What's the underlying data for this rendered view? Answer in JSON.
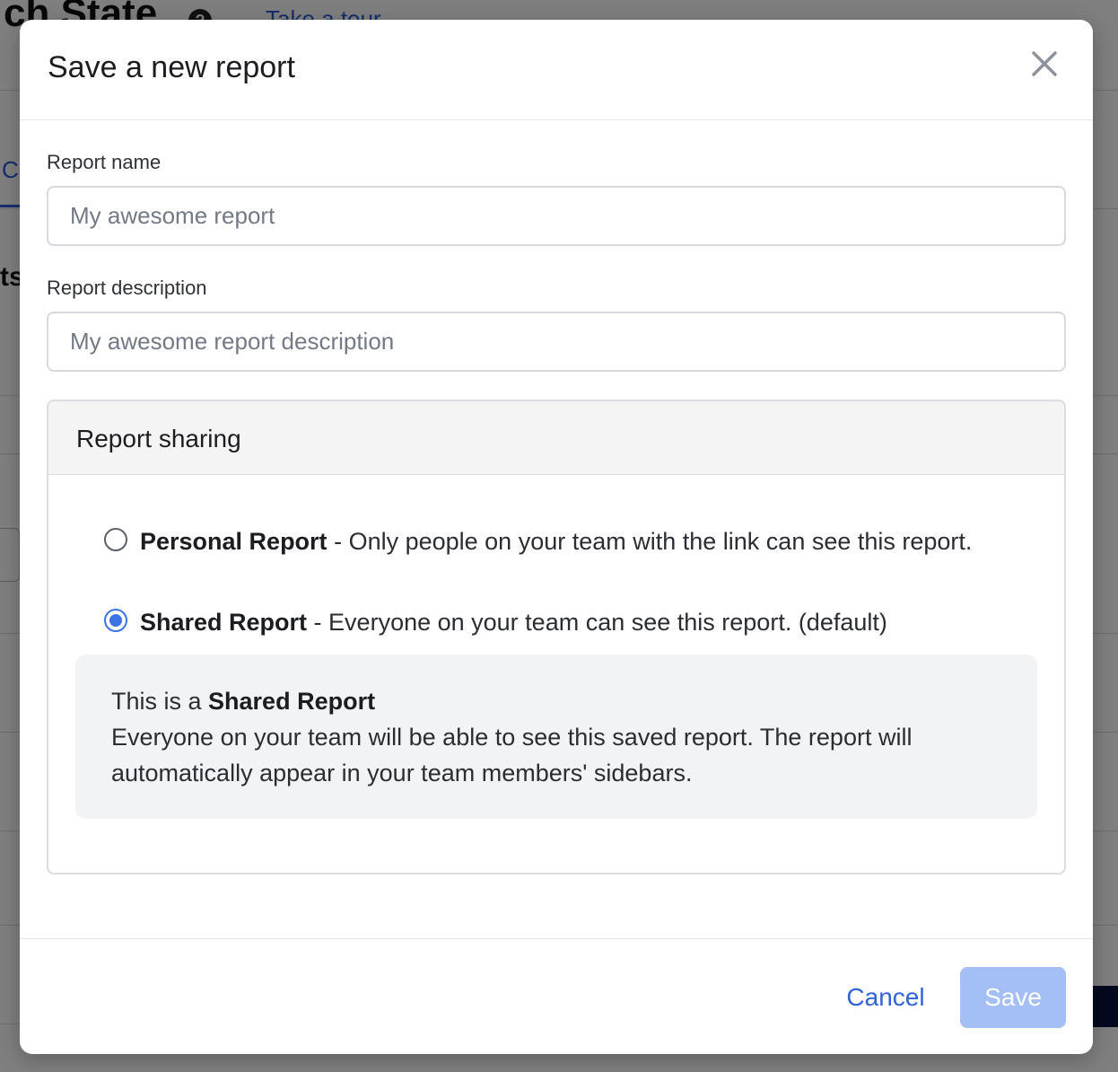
{
  "background": {
    "page_title": "ch State",
    "help_icon": "question-circle-icon",
    "tour_link": "Take a tour",
    "tab_partial": "C",
    "side_partial": "ts"
  },
  "modal": {
    "title": "Save a new report",
    "close_icon": "close-icon",
    "report_name": {
      "label": "Report name",
      "value": "",
      "placeholder": "My awesome report"
    },
    "report_description": {
      "label": "Report description",
      "value": "",
      "placeholder": "My awesome report description"
    },
    "sharing": {
      "title": "Report sharing",
      "options": [
        {
          "name": "Personal Report",
          "separator": " - ",
          "description": "Only people on your team with the link can see this report.",
          "checked": false
        },
        {
          "name": "Shared Report",
          "separator": " - ",
          "description": "Everyone on your team can see this report. (default)",
          "checked": true
        }
      ],
      "info": {
        "prefix": "This is a ",
        "strong": "Shared Report",
        "body": "Everyone on your team will be able to see this saved report. The report will automatically appear in your team members' sidebars."
      }
    },
    "footer": {
      "cancel_label": "Cancel",
      "save_label": "Save"
    }
  },
  "colors": {
    "accent": "#3b73e8",
    "link": "#2f63d6",
    "save_disabled": "#a4bff6"
  }
}
